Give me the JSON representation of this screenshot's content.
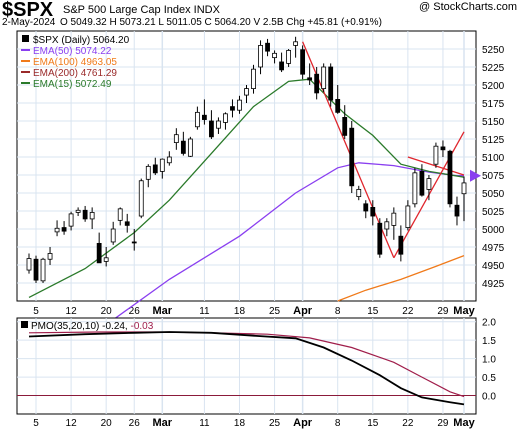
{
  "header": {
    "symbol": "$SPX",
    "name": "S&P 500 Large Cap Index  INDX",
    "date": "2-May-2024",
    "ohlc_text": "O 5049.32  H 5073.21  L 5011.05  C 5064.20  V 2.5B  Chg +45.81 (+0.91%)",
    "copyright": "@ StockCharts.com"
  },
  "colors": {
    "ema50": "#8a3ff0",
    "ema100": "#f07a1a",
    "ema200": "#9a2a2a",
    "ema15": "#2a7a2a",
    "trendline": "#e0262d",
    "pmo": "#000000",
    "pmo_signal": "#a01e4b",
    "grid": "#d9e4f0",
    "bg": "#ffffff"
  },
  "chart_data": [
    {
      "type": "candlestick",
      "title": "$SPX (Daily) 5064.20",
      "legend": [
        {
          "name": "$SPX (Daily)",
          "value": "5064.20"
        },
        {
          "name": "EMA(50)",
          "value": "5074.22"
        },
        {
          "name": "EMA(100)",
          "value": "4963.05"
        },
        {
          "name": "EMA(200)",
          "value": "4761.29"
        },
        {
          "name": "EMA(15)",
          "value": "5072.49"
        }
      ],
      "ylim": [
        4900,
        5275
      ],
      "yticks": [
        "4925",
        "4950",
        "4975",
        "5000",
        "5025",
        "5050",
        "5075",
        "5100",
        "5125",
        "5150",
        "5175",
        "5200",
        "5225",
        "5250"
      ],
      "xticks": [
        "5",
        "12",
        "20",
        "26",
        "Mar",
        "11",
        "18",
        "25",
        "Apr",
        "8",
        "15",
        "22",
        "29",
        "May"
      ],
      "x_tick_index": [
        1,
        6,
        11,
        15,
        19,
        25,
        30,
        35,
        39,
        44,
        49,
        54,
        59,
        62
      ],
      "last_value_marker": 5074,
      "candles": [
        [
          4943,
          4966,
          4938,
          4959
        ],
        [
          4958,
          4963,
          4925,
          4929
        ],
        [
          4928,
          4960,
          4925,
          4958
        ],
        [
          4958,
          4975,
          4950,
          4966
        ],
        [
          4996,
          5012,
          4990,
          5001
        ],
        [
          5002,
          5011,
          4992,
          4997
        ],
        [
          5004,
          5024,
          4998,
          5021
        ],
        [
          5023,
          5030,
          5018,
          5026
        ],
        [
          5026,
          5032,
          5010,
          5014
        ],
        [
          5014,
          5030,
          5000,
          5023
        ],
        [
          4980,
          4995,
          4960,
          4953
        ],
        [
          4955,
          4975,
          4948,
          4960
        ],
        [
          4982,
          5010,
          4978,
          5000
        ],
        [
          5012,
          5030,
          5005,
          5028
        ],
        [
          5010,
          5021,
          4995,
          5005
        ],
        [
          4982,
          5000,
          4970,
          4981
        ],
        [
          5018,
          5070,
          5015,
          5067
        ],
        [
          5069,
          5090,
          5058,
          5087
        ],
        [
          5089,
          5099,
          5075,
          5078
        ],
        [
          5080,
          5098,
          5070,
          5097
        ],
        [
          5092,
          5108,
          5088,
          5100
        ],
        [
          5120,
          5140,
          5110,
          5131
        ],
        [
          5122,
          5135,
          5102,
          5105
        ],
        [
          5101,
          5128,
          5100,
          5125
        ],
        [
          5142,
          5170,
          5138,
          5162
        ],
        [
          5158,
          5180,
          5145,
          5152
        ],
        [
          5150,
          5165,
          5125,
          5128
        ],
        [
          5140,
          5155,
          5132,
          5150
        ],
        [
          5148,
          5162,
          5138,
          5160
        ],
        [
          5170,
          5180,
          5155,
          5165
        ],
        [
          5165,
          5185,
          5160,
          5179
        ],
        [
          5186,
          5200,
          5175,
          5195
        ],
        [
          5195,
          5228,
          5188,
          5222
        ],
        [
          5225,
          5262,
          5215,
          5255
        ],
        [
          5258,
          5264,
          5240,
          5247
        ],
        [
          5238,
          5248,
          5230,
          5244
        ],
        [
          5232,
          5245,
          5218,
          5221
        ],
        [
          5230,
          5250,
          5225,
          5248
        ],
        [
          5255,
          5267,
          5238,
          5260
        ],
        [
          5249,
          5255,
          5208,
          5215
        ],
        [
          5210,
          5230,
          5200,
          5207
        ],
        [
          5215,
          5225,
          5180,
          5189
        ],
        [
          5195,
          5230,
          5190,
          5225
        ],
        [
          5225,
          5230,
          5170,
          5179
        ],
        [
          5180,
          5200,
          5160,
          5162
        ],
        [
          5155,
          5172,
          5125,
          5130
        ],
        [
          5140,
          5150,
          5050,
          5060
        ],
        [
          5045,
          5060,
          5040,
          5055
        ],
        [
          5035,
          5040,
          5015,
          5025
        ],
        [
          5030,
          5040,
          5005,
          5018
        ],
        [
          5008,
          5015,
          4960,
          4965
        ],
        [
          5000,
          5015,
          4990,
          5010
        ],
        [
          5005,
          5030,
          4985,
          5022
        ],
        [
          4990,
          5005,
          4955,
          4965
        ],
        [
          5002,
          5040,
          4998,
          5032
        ],
        [
          5035,
          5085,
          5030,
          5078
        ],
        [
          5080,
          5090,
          5045,
          5047
        ],
        [
          5055,
          5075,
          5040,
          5070
        ],
        [
          5090,
          5120,
          5085,
          5115
        ],
        [
          5114,
          5123,
          5100,
          5110
        ],
        [
          5108,
          5110,
          5030,
          5035
        ],
        [
          5033,
          5045,
          5005,
          5018
        ],
        [
          5049,
          5073,
          5011,
          5064
        ]
      ],
      "ema50": [
        [
          0,
          4820
        ],
        [
          10,
          4860
        ],
        [
          20,
          4930
        ],
        [
          30,
          4990
        ],
        [
          38,
          5050
        ],
        [
          44,
          5085
        ],
        [
          47,
          5092
        ],
        [
          52,
          5088
        ],
        [
          57,
          5079
        ],
        [
          61,
          5074
        ],
        [
          62,
          5074
        ]
      ],
      "ema15": [
        [
          0,
          4905
        ],
        [
          8,
          4945
        ],
        [
          15,
          4995
        ],
        [
          20,
          5040
        ],
        [
          26,
          5105
        ],
        [
          32,
          5170
        ],
        [
          37,
          5205
        ],
        [
          40,
          5208
        ],
        [
          45,
          5160
        ],
        [
          49,
          5130
        ],
        [
          53,
          5090
        ],
        [
          57,
          5080
        ],
        [
          62,
          5072
        ]
      ],
      "ema100": [
        [
          44,
          4900
        ],
        [
          48,
          4915
        ],
        [
          53,
          4930
        ],
        [
          58,
          4948
        ],
        [
          62,
          4963
        ]
      ],
      "trendlines": [
        [
          39,
          5260,
          52,
          4960
        ],
        [
          52,
          4960,
          62,
          5135
        ],
        [
          54,
          5100,
          62,
          5075
        ]
      ]
    },
    {
      "type": "line",
      "title": "PMO(35,20,10) -0.24, -0.03",
      "legend": [
        {
          "name": "PMO(35,20,10)",
          "value": "-0.24"
        },
        {
          "name": "",
          "value": "-0.03"
        }
      ],
      "ylim": [
        -0.5,
        2.1
      ],
      "yticks": [
        "0.0",
        "0.5",
        "1.0",
        "1.5",
        "2.0"
      ],
      "zero_line": 0,
      "pmo": [
        [
          0,
          1.6
        ],
        [
          8,
          1.66
        ],
        [
          15,
          1.7
        ],
        [
          20,
          1.72
        ],
        [
          26,
          1.7
        ],
        [
          32,
          1.62
        ],
        [
          38,
          1.55
        ],
        [
          42,
          1.3
        ],
        [
          46,
          0.95
        ],
        [
          50,
          0.55
        ],
        [
          53,
          0.2
        ],
        [
          56,
          -0.05
        ],
        [
          60,
          -0.18
        ],
        [
          62,
          -0.24
        ]
      ],
      "signal": [
        [
          0,
          1.7
        ],
        [
          10,
          1.72
        ],
        [
          18,
          1.72
        ],
        [
          26,
          1.7
        ],
        [
          34,
          1.66
        ],
        [
          40,
          1.56
        ],
        [
          46,
          1.3
        ],
        [
          52,
          0.9
        ],
        [
          56,
          0.5
        ],
        [
          60,
          0.1
        ],
        [
          62,
          -0.03
        ]
      ]
    }
  ]
}
